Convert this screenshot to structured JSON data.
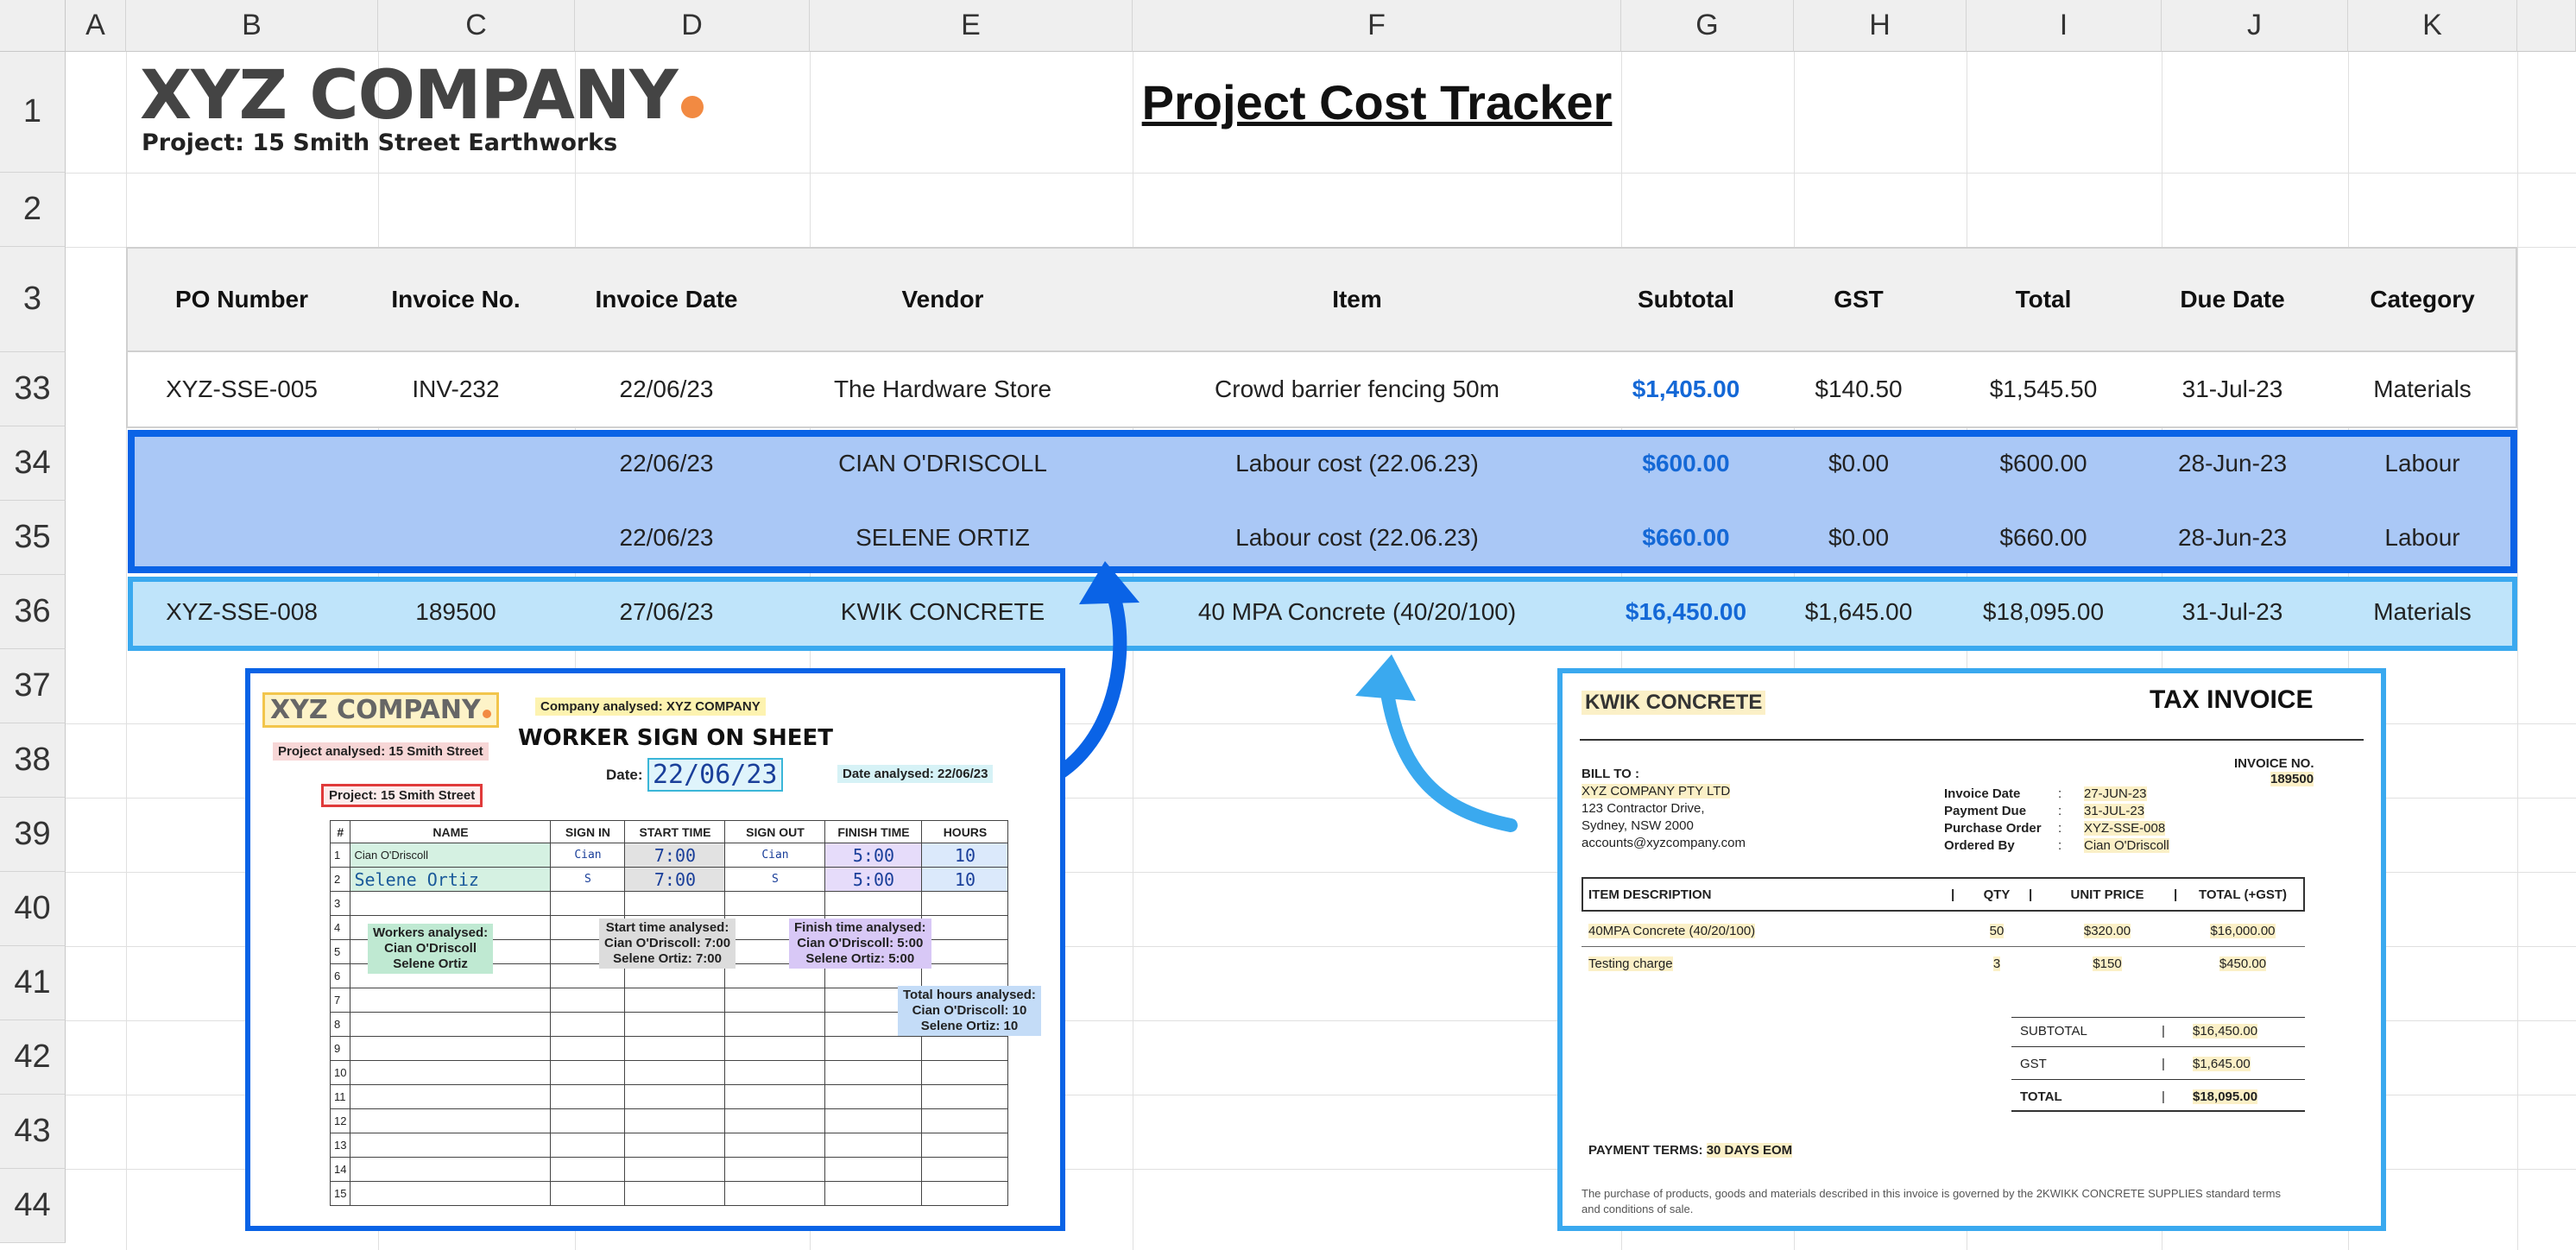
{
  "columns": [
    "A",
    "B",
    "C",
    "D",
    "E",
    "F",
    "G",
    "H",
    "I",
    "J",
    "K"
  ],
  "rows": [
    "1",
    "2",
    "3",
    "33",
    "34",
    "35",
    "36",
    "37",
    "38",
    "39",
    "40",
    "41",
    "42",
    "43",
    "44"
  ],
  "logo": {
    "name": "XYZ COMPANY",
    "project": "Project:  15 Smith Street Earthworks"
  },
  "title": "Project Cost Tracker",
  "table": {
    "headers": [
      "PO Number",
      "Invoice No.",
      "Invoice Date",
      "Vendor",
      "Item",
      "Subtotal",
      "GST",
      "Total",
      "Due Date",
      "Category"
    ],
    "rows": [
      [
        "XYZ-SSE-005",
        "INV-232",
        "22/06/23",
        "The Hardware Store",
        "Crowd barrier fencing 50m",
        "$1,405.00",
        "$140.50",
        "$1,545.50",
        "31-Jul-23",
        "Materials"
      ],
      [
        "",
        "",
        "22/06/23",
        "CIAN O'DRISCOLL",
        "Labour cost (22.06.23)",
        "$600.00",
        "$0.00",
        "$600.00",
        "28-Jun-23",
        "Labour"
      ],
      [
        "",
        "",
        "22/06/23",
        "SELENE ORTIZ",
        "Labour cost (22.06.23)",
        "$660.00",
        "$0.00",
        "$660.00",
        "28-Jun-23",
        "Labour"
      ],
      [
        "XYZ-SSE-008",
        "189500",
        "27/06/23",
        "KWIK CONCRETE",
        "40 MPA Concrete (40/20/100)",
        "$16,450.00",
        "$1,645.00",
        "$18,095.00",
        "31-Jul-23",
        "Materials"
      ]
    ]
  },
  "worker_sheet": {
    "logo": "XYZ COMPANY",
    "company_tag": "Company analysed: XYZ COMPANY",
    "project_tag": "Project analysed: 15 Smith Street",
    "project_box": "Project: 15 Smith Street",
    "heading": "WORKER SIGN ON SHEET",
    "date_label": "Date:",
    "date_value": "22/06/23",
    "date_tag": "Date analysed: 22/06/23",
    "columns": [
      "#",
      "NAME",
      "SIGN IN",
      "START TIME",
      "SIGN OUT",
      "FINISH TIME",
      "HOURS"
    ],
    "entries": [
      {
        "name": "Cian O'Driscoll",
        "sign_in": "Cian",
        "start": "7:00",
        "sign_out": "Cian",
        "finish": "5:00",
        "hours": "10"
      },
      {
        "name": "Selene Ortiz",
        "sign_in": "S",
        "start": "7:00",
        "sign_out": "S",
        "finish": "5:00",
        "hours": "10"
      }
    ],
    "row_numbers": [
      "1",
      "2",
      "3",
      "4",
      "5",
      "6",
      "7",
      "8",
      "9",
      "10",
      "11",
      "12",
      "13",
      "14",
      "15"
    ],
    "workers_tag": [
      "Workers analysed:",
      "Cian O'Driscoll",
      "Selene Ortiz"
    ],
    "start_tag": [
      "Start time analysed:",
      "Cian O'Driscoll: 7:00",
      "Selene Ortiz: 7:00"
    ],
    "finish_tag": [
      "Finish time analysed:",
      "Cian O'Driscoll: 5:00",
      "Selene Ortiz: 5:00"
    ],
    "hours_tag": [
      "Total hours analysed:",
      "Cian O'Driscoll: 10",
      "Selene Ortiz: 10"
    ]
  },
  "invoice": {
    "vendor": "KWIK CONCRETE",
    "title": "TAX INVOICE",
    "invoice_no_label": "INVOICE NO.",
    "invoice_no": "189500",
    "bill_to_label": "BILL TO :",
    "bill_to": [
      "XYZ COMPANY PTY LTD",
      "123 Contractor Drive,",
      "Sydney, NSW 2000",
      "accounts@xyzcompany.com"
    ],
    "meta_labels": [
      "Invoice Date",
      "Payment Due",
      "Purchase Order",
      "Ordered By"
    ],
    "meta_values": [
      "27-JUN-23",
      "31-JUL-23",
      "XYZ-SSE-008",
      "Cian O'Driscoll"
    ],
    "item_headers": [
      "ITEM DESCRIPTION",
      "QTY",
      "UNIT PRICE",
      "TOTAL (+GST)"
    ],
    "items": [
      [
        "40MPA Concrete (40/20/100)",
        "50",
        "$320.00",
        "$16,000.00"
      ],
      [
        "Testing charge",
        "3",
        "$150",
        "$450.00"
      ]
    ],
    "totals": [
      [
        "SUBTOTAL",
        "$16,450.00"
      ],
      [
        "GST",
        "$1,645.00"
      ],
      [
        "TOTAL",
        "$18,095.00"
      ]
    ],
    "payment_terms_label": "PAYMENT TERMS:",
    "payment_terms": "30 DAYS EOM",
    "footer": [
      "The purchase of products, goods and materials described in this invoice is governed by the 2KWIKK CONCRETE SUPPLIES standard terms",
      "and conditions of sale."
    ]
  },
  "colors": {
    "labour_border": "#0a63e6",
    "labour_fill": "#aac8f6",
    "concrete_border": "#3aa9ef",
    "concrete_fill": "#bfe4fa",
    "subtotal_text": "#1468d6",
    "logo_dot": "#f28a42"
  }
}
